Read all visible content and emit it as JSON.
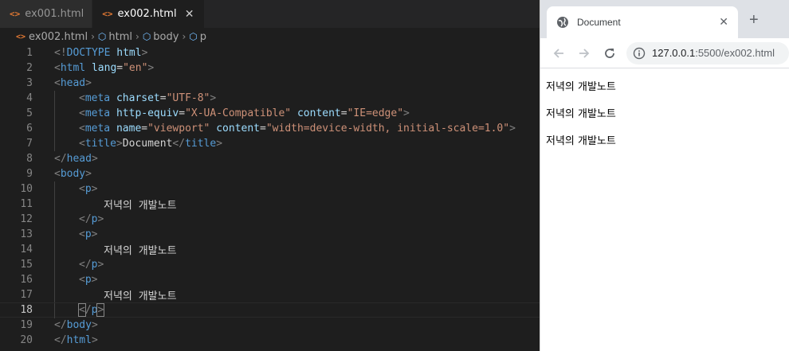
{
  "editor": {
    "tabs": [
      {
        "icon": "<>",
        "label": "ex001.html",
        "active": false
      },
      {
        "icon": "<>",
        "label": "ex002.html",
        "active": true,
        "close": "✕"
      }
    ],
    "breadcrumb": {
      "file": "ex002.html",
      "items": [
        "html",
        "body",
        "p"
      ]
    },
    "current_line": 18
  },
  "browser": {
    "tab_title": "Document",
    "tab_close": "✕",
    "new_tab": "+",
    "url_host": "127.0.0.1",
    "url_rest": ":5500/ex002.html",
    "paragraphs": [
      "저녁의 개발노트",
      "저녁의 개발노트",
      "저녁의 개발노트"
    ]
  },
  "code_lines": [
    {
      "n": "1",
      "indent": 0,
      "tokens": [
        [
          "punct",
          "<!"
        ],
        [
          "tag",
          "DOCTYPE"
        ],
        [
          "text",
          " "
        ],
        [
          "attr",
          "html"
        ],
        [
          "punct",
          ">"
        ]
      ]
    },
    {
      "n": "2",
      "indent": 0,
      "tokens": [
        [
          "punct",
          "<"
        ],
        [
          "tag",
          "html"
        ],
        [
          "text",
          " "
        ],
        [
          "attr",
          "lang"
        ],
        [
          "text",
          "="
        ],
        [
          "str",
          "\"en\""
        ],
        [
          "punct",
          ">"
        ]
      ]
    },
    {
      "n": "3",
      "indent": 0,
      "tokens": [
        [
          "punct",
          "<"
        ],
        [
          "tag",
          "head"
        ],
        [
          "punct",
          ">"
        ]
      ]
    },
    {
      "n": "4",
      "indent": 1,
      "tokens": [
        [
          "punct",
          "<"
        ],
        [
          "tag",
          "meta"
        ],
        [
          "text",
          " "
        ],
        [
          "attr",
          "charset"
        ],
        [
          "text",
          "="
        ],
        [
          "str",
          "\"UTF-8\""
        ],
        [
          "punct",
          ">"
        ]
      ]
    },
    {
      "n": "5",
      "indent": 1,
      "tokens": [
        [
          "punct",
          "<"
        ],
        [
          "tag",
          "meta"
        ],
        [
          "text",
          " "
        ],
        [
          "attr",
          "http-equiv"
        ],
        [
          "text",
          "="
        ],
        [
          "str",
          "\"X-UA-Compatible\""
        ],
        [
          "text",
          " "
        ],
        [
          "attr",
          "content"
        ],
        [
          "text",
          "="
        ],
        [
          "str",
          "\"IE=edge\""
        ],
        [
          "punct",
          ">"
        ]
      ]
    },
    {
      "n": "6",
      "indent": 1,
      "tokens": [
        [
          "punct",
          "<"
        ],
        [
          "tag",
          "meta"
        ],
        [
          "text",
          " "
        ],
        [
          "attr",
          "name"
        ],
        [
          "text",
          "="
        ],
        [
          "str",
          "\"viewport\""
        ],
        [
          "text",
          " "
        ],
        [
          "attr",
          "content"
        ],
        [
          "text",
          "="
        ],
        [
          "str",
          "\"width=device-width, initial-scale=1.0\""
        ],
        [
          "punct",
          ">"
        ]
      ]
    },
    {
      "n": "7",
      "indent": 1,
      "tokens": [
        [
          "punct",
          "<"
        ],
        [
          "tag",
          "title"
        ],
        [
          "punct",
          ">"
        ],
        [
          "text",
          "Document"
        ],
        [
          "punct",
          "</"
        ],
        [
          "tag",
          "title"
        ],
        [
          "punct",
          ">"
        ]
      ]
    },
    {
      "n": "8",
      "indent": 0,
      "tokens": [
        [
          "punct",
          "</"
        ],
        [
          "tag",
          "head"
        ],
        [
          "punct",
          ">"
        ]
      ]
    },
    {
      "n": "9",
      "indent": 0,
      "tokens": [
        [
          "punct",
          "<"
        ],
        [
          "tag",
          "body"
        ],
        [
          "punct",
          ">"
        ]
      ]
    },
    {
      "n": "10",
      "indent": 1,
      "tokens": [
        [
          "punct",
          "<"
        ],
        [
          "tag",
          "p"
        ],
        [
          "punct",
          ">"
        ]
      ]
    },
    {
      "n": "11",
      "indent": 2,
      "tokens": [
        [
          "text",
          "저녁의 개발노트"
        ]
      ]
    },
    {
      "n": "12",
      "indent": 1,
      "tokens": [
        [
          "punct",
          "</"
        ],
        [
          "tag",
          "p"
        ],
        [
          "punct",
          ">"
        ]
      ]
    },
    {
      "n": "13",
      "indent": 1,
      "tokens": [
        [
          "punct",
          "<"
        ],
        [
          "tag",
          "p"
        ],
        [
          "punct",
          ">"
        ]
      ]
    },
    {
      "n": "14",
      "indent": 2,
      "tokens": [
        [
          "text",
          "저녁의 개발노트"
        ]
      ]
    },
    {
      "n": "15",
      "indent": 1,
      "tokens": [
        [
          "punct",
          "</"
        ],
        [
          "tag",
          "p"
        ],
        [
          "punct",
          ">"
        ]
      ]
    },
    {
      "n": "16",
      "indent": 1,
      "tokens": [
        [
          "punct",
          "<"
        ],
        [
          "tag",
          "p"
        ],
        [
          "punct",
          ">"
        ]
      ]
    },
    {
      "n": "17",
      "indent": 2,
      "tokens": [
        [
          "text",
          "저녁의 개발노트"
        ]
      ]
    },
    {
      "n": "18",
      "indent": 1,
      "tokens": [
        [
          "hl",
          "<"
        ],
        [
          "punct",
          "/"
        ],
        [
          "tag",
          "p"
        ],
        [
          "hl",
          ">"
        ]
      ]
    },
    {
      "n": "19",
      "indent": 0,
      "tokens": [
        [
          "punct",
          "</"
        ],
        [
          "tag",
          "body"
        ],
        [
          "punct",
          ">"
        ]
      ]
    },
    {
      "n": "20",
      "indent": 0,
      "tokens": [
        [
          "punct",
          "</"
        ],
        [
          "tag",
          "html"
        ],
        [
          "punct",
          ">"
        ]
      ]
    }
  ]
}
